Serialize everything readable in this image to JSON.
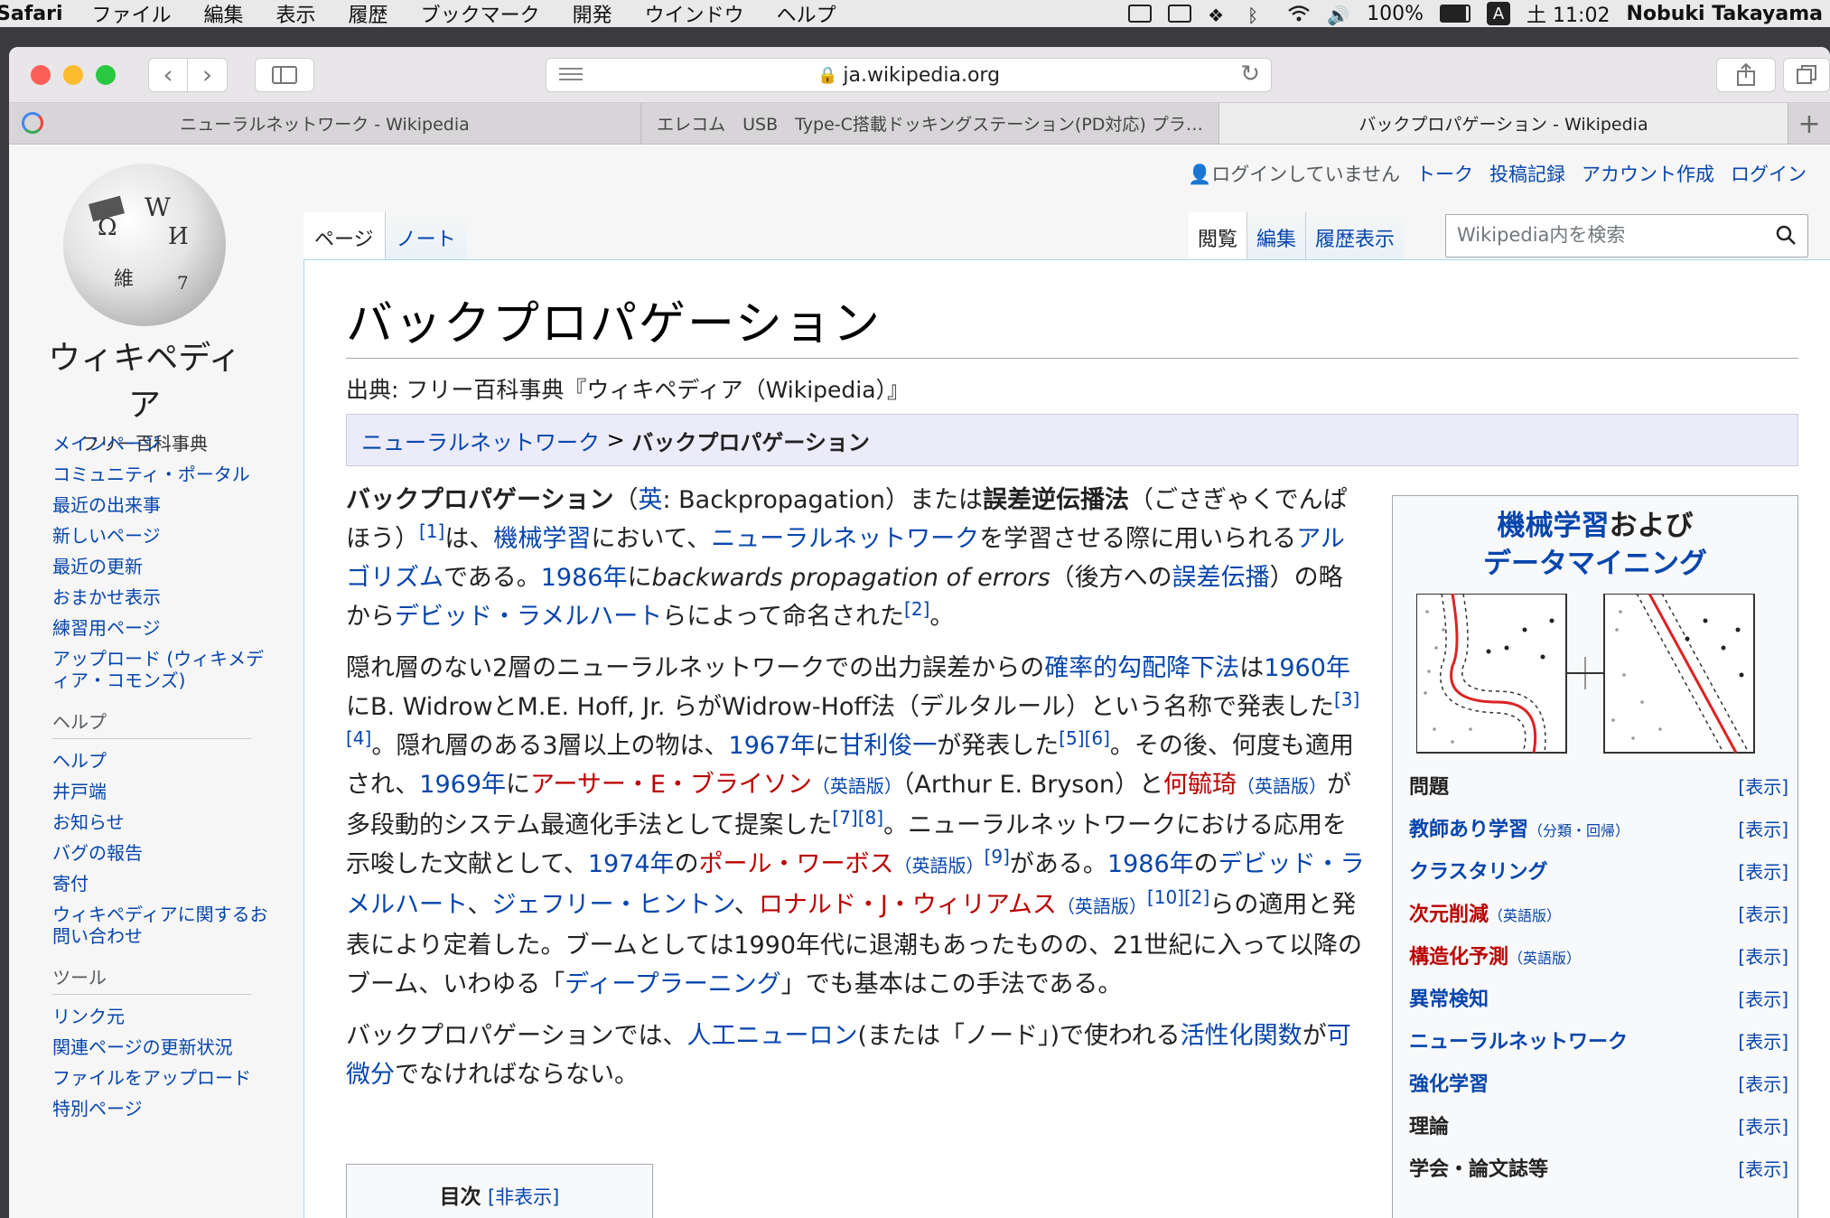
{
  "menubar": {
    "app": "Safari",
    "items": [
      "ファイル",
      "編集",
      "表示",
      "履歴",
      "ブックマーク",
      "開発",
      "ウインドウ",
      "ヘルプ"
    ],
    "battery": "100%",
    "input_mode": "A",
    "clock": "土 11:02",
    "user": "Nobuki Takayama"
  },
  "browser": {
    "url": "ja.wikipedia.org",
    "tabs": [
      {
        "title": "ニューラルネットワーク - Wikipedia"
      },
      {
        "title": "エレコム　USB　Type-C搭載ドッキングステーション(PD対応)  プラ…"
      },
      {
        "title": "バックプロパゲーション - Wikipedia"
      }
    ],
    "new_tab": "+"
  },
  "wiki": {
    "logo_wordmark": "ウィキペディア",
    "logo_tagline": "フリー百科事典",
    "nav_main": [
      "メインページ",
      "コミュニティ・ポータル",
      "最近の出来事",
      "新しいページ",
      "最近の更新",
      "おまかせ表示",
      "練習用ページ",
      "アップロード (ウィキメディア・コモンズ)"
    ],
    "help_heading": "ヘルプ",
    "nav_help": [
      "ヘルプ",
      "井戸端",
      "お知らせ",
      "バグの報告",
      "寄付",
      "ウィキペディアに関するお問い合わせ"
    ],
    "tools_heading": "ツール",
    "nav_tools": [
      "リンク元",
      "関連ページの更新状況",
      "ファイルをアップロード",
      "特別ページ"
    ],
    "personal": {
      "not_logged_in": "ログインしていません",
      "talk": "トーク",
      "contribs": "投稿記録",
      "create": "アカウント作成",
      "login": "ログイン"
    },
    "ns_tabs": {
      "page": "ページ",
      "note": "ノート"
    },
    "view_tabs": {
      "read": "閲覧",
      "edit": "編集",
      "history": "履歴表示"
    },
    "search_placeholder": "Wikipedia内を検索",
    "title": "バックプロパゲーション",
    "site_sub": "出典: フリー百科事典『ウィキペディア（Wikipedia）』",
    "breadcrumb": {
      "parent": "ニューラルネットワーク",
      "sep": " > ",
      "current": "バックプロパゲーション"
    },
    "p1": {
      "bold1": "バックプロパゲーション",
      "t1": "（",
      "en_link": "英",
      "t2": ": Backpropagation）または",
      "bold2": "誤差逆伝播法",
      "t3": "（ごさぎゃくでんぱほう）",
      "ref1": "[1]",
      "t4": "は、",
      "l1": "機械学習",
      "t5": "において、",
      "l2": "ニューラルネットワーク",
      "t6": "を学習させる際に用いられる",
      "l3": "アルゴリズム",
      "t7": "である。",
      "l4": "1986年",
      "t8": "に",
      "italic": "backwards propagation of errors",
      "t9": "（後方への",
      "l5": "誤差伝播",
      "t10": "）の略から",
      "l6": "デビッド・ラメルハート",
      "t11": "らによって命名された",
      "ref2": "[2]",
      "t12": "。"
    },
    "p2": {
      "t1": "隠れ層のない2層のニューラルネットワークでの出力誤差からの",
      "l1": "確率的勾配降下法",
      "t2": "は",
      "l2": "1960年",
      "t3": "にB. WidrowとM.E. Hoff, Jr. らがWidrow-Hoff法（デルタルール）という名称で発表した",
      "ref1": "[3][4]",
      "t4": "。隠れ層のある3層以上の物は、",
      "l3": "1967年",
      "t5": "に",
      "l4": "甘利俊一",
      "t6": "が発表した",
      "ref2": "[5][6]",
      "t7": "。その後、何度も適用され、",
      "l5": "1969年",
      "t8": "に",
      "r1": "アーサー・E・ブライソン",
      "en1": "（英語版）",
      "t9": "（Arthur E. Bryson）と",
      "r2": "何毓琦",
      "en2": "（英語版）",
      "t10": "が多段動的システム最適化手法として提案した",
      "ref3": "[7][8]",
      "t11": "。ニューラルネットワークにおける応用を示唆した文献として、",
      "l6": "1974年",
      "t12": "の",
      "r3": "ポール・ワーボス",
      "en3": "（英語版）",
      "ref4": "[9]",
      "t13": "がある。",
      "l7": "1986年",
      "t14": "の",
      "l8": "デビッド・ラメルハート",
      "t15": "、",
      "l9": "ジェフリー・ヒントン",
      "t16": "、",
      "r4": "ロナルド・J・ウィリアムス",
      "en4": "（英語版）",
      "ref5": "[10][2]",
      "t17": "らの適用と発表により定着した。ブームとしては1990年代に退潮もあったものの、21世紀に入って以降のブーム、いわゆる「",
      "l10": "ディープラーニング",
      "t18": "」でも基本はこの手法である。"
    },
    "p3": {
      "t1": "バックプロパゲーションでは、",
      "l1": "人工ニューロン",
      "t2": "(または「ノード」)で使われる",
      "l2": "活性化関数",
      "t3": "が",
      "l3": "可微分",
      "t4": "でなければならない。"
    },
    "toc": {
      "title": "目次",
      "toggle": "[非表示]"
    },
    "infobox": {
      "title_link": "機械学習",
      "title_rest": "および",
      "title_link2": "データマイニング",
      "rows": [
        {
          "label": "問題",
          "note": "",
          "style": "plain",
          "action": "[表示]"
        },
        {
          "label": "教師あり学習",
          "note": "（分類・回帰）",
          "style": "link",
          "action": "[表示]"
        },
        {
          "label": "クラスタリング",
          "note": "",
          "style": "link",
          "action": "[表示]"
        },
        {
          "label": "次元削減",
          "note": "（英語版）",
          "style": "red",
          "action": "[表示]"
        },
        {
          "label": "構造化予測",
          "note": "（英語版）",
          "style": "red",
          "action": "[表示]"
        },
        {
          "label": "異常検知",
          "note": "",
          "style": "link",
          "action": "[表示]"
        },
        {
          "label": "ニューラルネットワーク",
          "note": "",
          "style": "link",
          "action": "[表示]"
        },
        {
          "label": "強化学習",
          "note": "",
          "style": "link",
          "action": "[表示]"
        },
        {
          "label": "理論",
          "note": "",
          "style": "plain",
          "action": "[表示]"
        },
        {
          "label": "学会・論文誌等",
          "note": "",
          "style": "plain",
          "action": "[表示]"
        }
      ]
    }
  }
}
